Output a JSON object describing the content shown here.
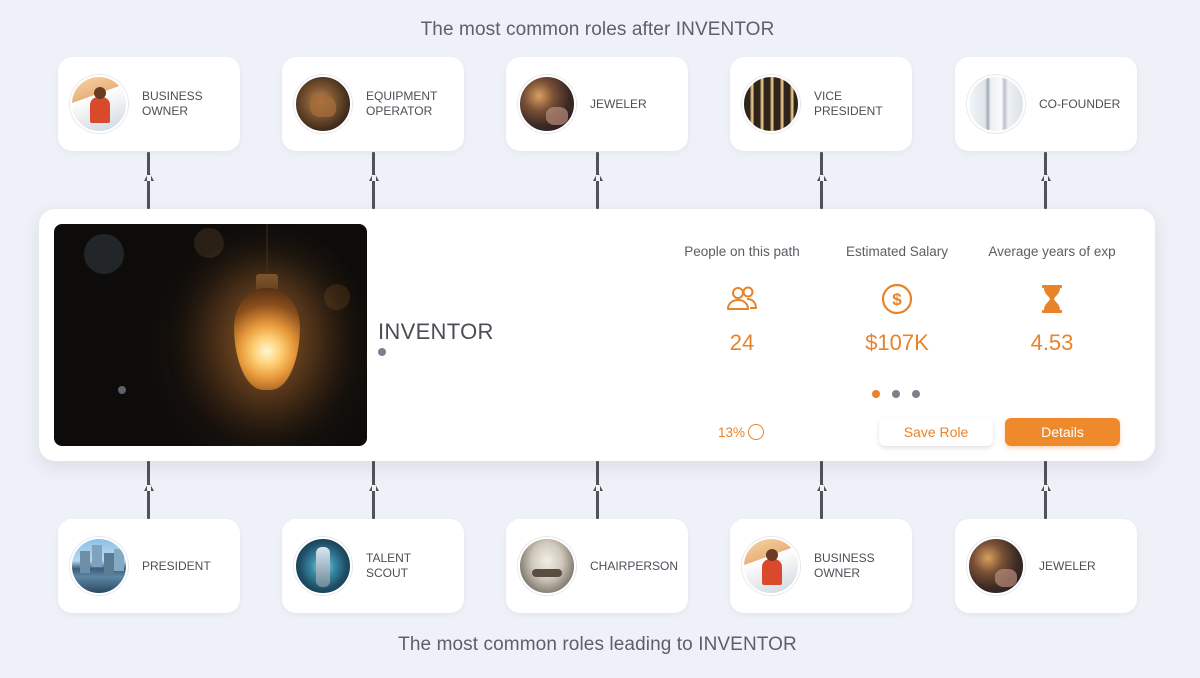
{
  "headings": {
    "top": "The most common roles after INVENTOR",
    "bottom": "The most common roles leading to INVENTOR"
  },
  "roles_after": [
    {
      "label": "BUSINESS\nOWNER",
      "icon": "business-owner-photo"
    },
    {
      "label": "EQUIPMENT\nOPERATOR",
      "icon": "equipment-operator-photo"
    },
    {
      "label": "JEWELER",
      "icon": "jeweler-photo"
    },
    {
      "label": "VICE\nPRESIDENT",
      "icon": "vice-president-photo"
    },
    {
      "label": "CO-FOUNDER",
      "icon": "co-founder-photo"
    }
  ],
  "roles_before": [
    {
      "label": "PRESIDENT",
      "icon": "president-photo"
    },
    {
      "label": "TALENT\nSCOUT",
      "icon": "talent-scout-photo"
    },
    {
      "label": "CHAIRPERSON",
      "icon": "chairperson-photo"
    },
    {
      "label": "BUSINESS\nOWNER",
      "icon": "business-owner-photo"
    },
    {
      "label": "JEWELER",
      "icon": "jeweler-photo"
    }
  ],
  "main": {
    "title": "INVENTOR",
    "image": "light-bulb-photo",
    "stats": [
      {
        "label": "People on this path",
        "value": "24",
        "icon": "people-icon"
      },
      {
        "label": "Estimated Salary",
        "value": "$107K",
        "icon": "dollar-icon"
      },
      {
        "label": "Average years of exp",
        "value": "4.53",
        "icon": "hourglass-icon"
      }
    ],
    "carousel": {
      "pages": 3,
      "active": 0
    },
    "progress": {
      "text": "13%",
      "value": 0.13
    },
    "save_label": "Save Role",
    "details_label": "Details"
  },
  "colors": {
    "accent": "#e8832a",
    "background": "#eef1f7",
    "card": "#ffffff",
    "connector": "#4f5257"
  }
}
